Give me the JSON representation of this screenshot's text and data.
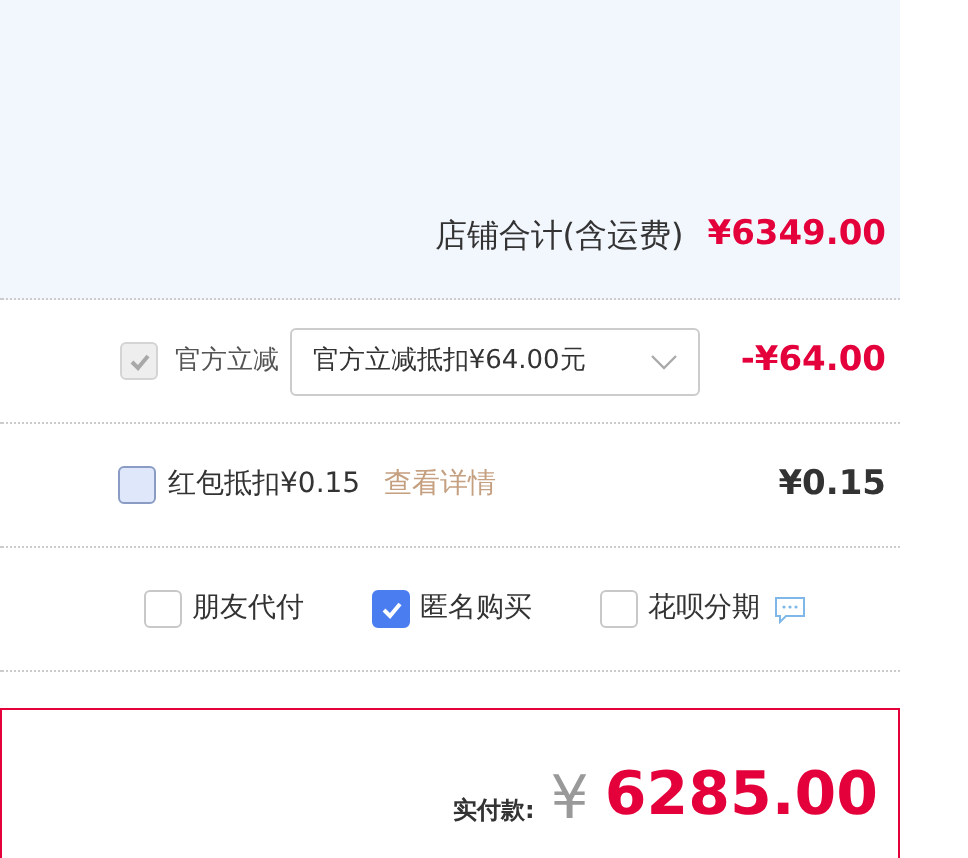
{
  "shop_total": {
    "label": "店铺合计(含运费)",
    "amount": "¥6349.00"
  },
  "official_discount": {
    "checked": true,
    "disabled": true,
    "label": "官方立减",
    "select_value": "官方立减抵扣¥64.00元",
    "amount": "-¥64.00"
  },
  "red_packet": {
    "checked": false,
    "label": "红包抵扣¥0.15",
    "link": "查看详情",
    "amount": "¥0.15"
  },
  "options": [
    {
      "label": "朋友代付",
      "checked": false,
      "help": false
    },
    {
      "label": "匿名购买",
      "checked": true,
      "help": false
    },
    {
      "label": "花呗分期",
      "checked": false,
      "help": true
    }
  ],
  "payment": {
    "label": "实付款:",
    "currency": "¥",
    "amount": "6285.00"
  }
}
